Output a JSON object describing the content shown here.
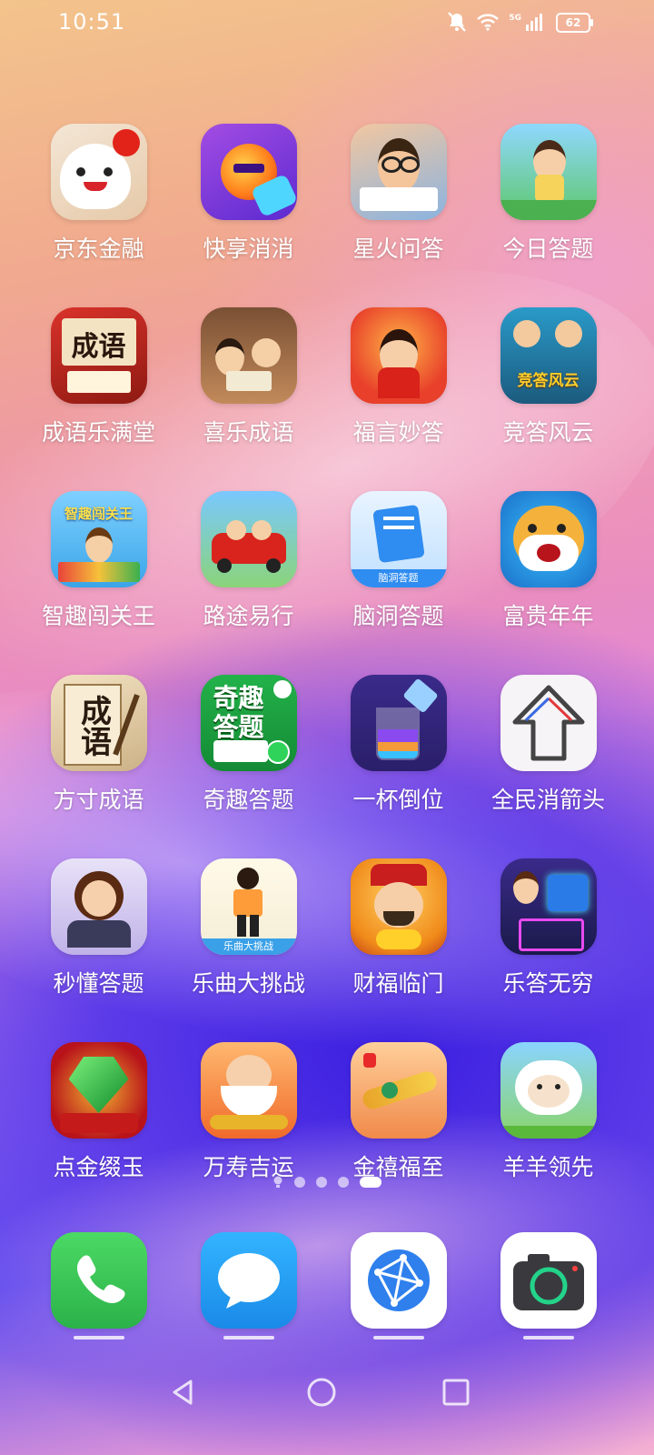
{
  "status_bar": {
    "time": "10:51",
    "battery": "62",
    "network": "5G"
  },
  "apps": [
    {
      "label": "京东金融",
      "icon": "jd-finance-icon"
    },
    {
      "label": "快享消消",
      "icon": "kuaixiang-icon"
    },
    {
      "label": "星火问答",
      "icon": "xinghuo-icon"
    },
    {
      "label": "今日答题",
      "icon": "jinri-icon"
    },
    {
      "label": "成语乐满堂",
      "icon": "chengyu-lemantang-icon",
      "icon_text": "成语"
    },
    {
      "label": "喜乐成语",
      "icon": "xile-chengyu-icon"
    },
    {
      "label": "福言妙答",
      "icon": "fuyan-icon"
    },
    {
      "label": "竞答风云",
      "icon": "jingda-icon",
      "icon_text": "竞答风云"
    },
    {
      "label": "智趣闯关王",
      "icon": "zhiqu-icon",
      "icon_text": "智趣闯关王"
    },
    {
      "label": "路途易行",
      "icon": "lutu-icon"
    },
    {
      "label": "脑洞答题",
      "icon": "naodong-icon",
      "icon_text": "脑洞答题"
    },
    {
      "label": "富贵年年",
      "icon": "fugui-icon"
    },
    {
      "label": "方寸成语",
      "icon": "fangcun-icon",
      "icon_text": "成语"
    },
    {
      "label": "奇趣答题",
      "icon": "qiqu-icon",
      "icon_text": "奇趣答题"
    },
    {
      "label": "一杯倒位",
      "icon": "yibei-icon"
    },
    {
      "label": "全民消箭头",
      "icon": "arrow-icon"
    },
    {
      "label": "秒懂答题",
      "icon": "miaodong-icon"
    },
    {
      "label": "乐曲大挑战",
      "icon": "lequ-icon",
      "icon_text": "乐曲大挑战"
    },
    {
      "label": "财福临门",
      "icon": "caifu-icon"
    },
    {
      "label": "乐答无穷",
      "icon": "leda-icon"
    },
    {
      "label": "点金缀玉",
      "icon": "emerald-icon"
    },
    {
      "label": "万寿吉运",
      "icon": "wanshou-icon"
    },
    {
      "label": "金禧福至",
      "icon": "jinxi-icon"
    },
    {
      "label": "羊羊领先",
      "icon": "sheep-icon"
    }
  ],
  "dock": [
    {
      "name": "phone-icon"
    },
    {
      "name": "messages-icon"
    },
    {
      "name": "browser-icon"
    },
    {
      "name": "camera-icon"
    }
  ],
  "page_indicator": {
    "pages": 5,
    "active": 5
  },
  "colors": {
    "phone": "#34c759",
    "messages": "#1e9bff",
    "browser": "#2f80ed",
    "camera_ring": "#23d38a"
  }
}
